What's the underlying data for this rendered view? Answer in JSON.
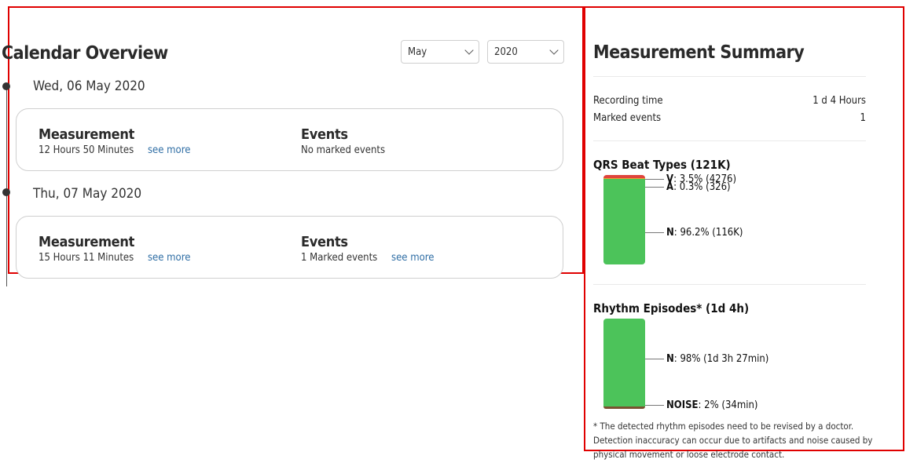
{
  "calendar": {
    "title": "Calendar Overview",
    "month": {
      "selected": "May",
      "options": [
        "May"
      ]
    },
    "year": {
      "selected": "2020",
      "options": [
        "2020"
      ]
    },
    "days": [
      {
        "date": "Wed, 06 May 2020",
        "measurement_label": "Measurement",
        "measurement_value": "12 Hours 50 Minutes",
        "measurement_link": "see more",
        "events_label": "Events",
        "events_value": "No marked events",
        "events_link": ""
      },
      {
        "date": "Thu, 07 May 2020",
        "measurement_label": "Measurement",
        "measurement_value": "15 Hours 11 Minutes",
        "measurement_link": "see more",
        "events_label": "Events",
        "events_value": "1 Marked events",
        "events_link": "see more"
      }
    ]
  },
  "summary": {
    "title": "Measurement Summary",
    "recording_label": "Recording time",
    "recording_value": "1 d 4 Hours",
    "marked_label": "Marked events",
    "marked_value": "1",
    "qrs": {
      "title": "QRS Beat Types (121K)",
      "segments": [
        {
          "key": "V",
          "text": ": 3.5% (4276)",
          "percent": 3.5,
          "color": "#e0443c"
        },
        {
          "key": "A",
          "text": ": 0.3% (326)",
          "percent": 0.3,
          "color": "#f0a030"
        },
        {
          "key": "N",
          "text": ": 96.2% (116K)",
          "percent": 96.2,
          "color": "#4cc35a"
        }
      ]
    },
    "rhythm": {
      "title": "Rhythm Episodes* (1d 4h)",
      "segments": [
        {
          "key": "N",
          "text": ": 98% (1d 3h 27min)",
          "percent": 98,
          "color": "#4cc35a"
        },
        {
          "key": "NOISE",
          "text": ": 2% (34min)",
          "percent": 2,
          "color": "#7a5230"
        }
      ]
    },
    "note": "* The detected rhythm episodes need to be revised by a doctor. Detection inaccuracy can occur due to artifacts and noise caused by physical movement or loose electrode contact."
  }
}
